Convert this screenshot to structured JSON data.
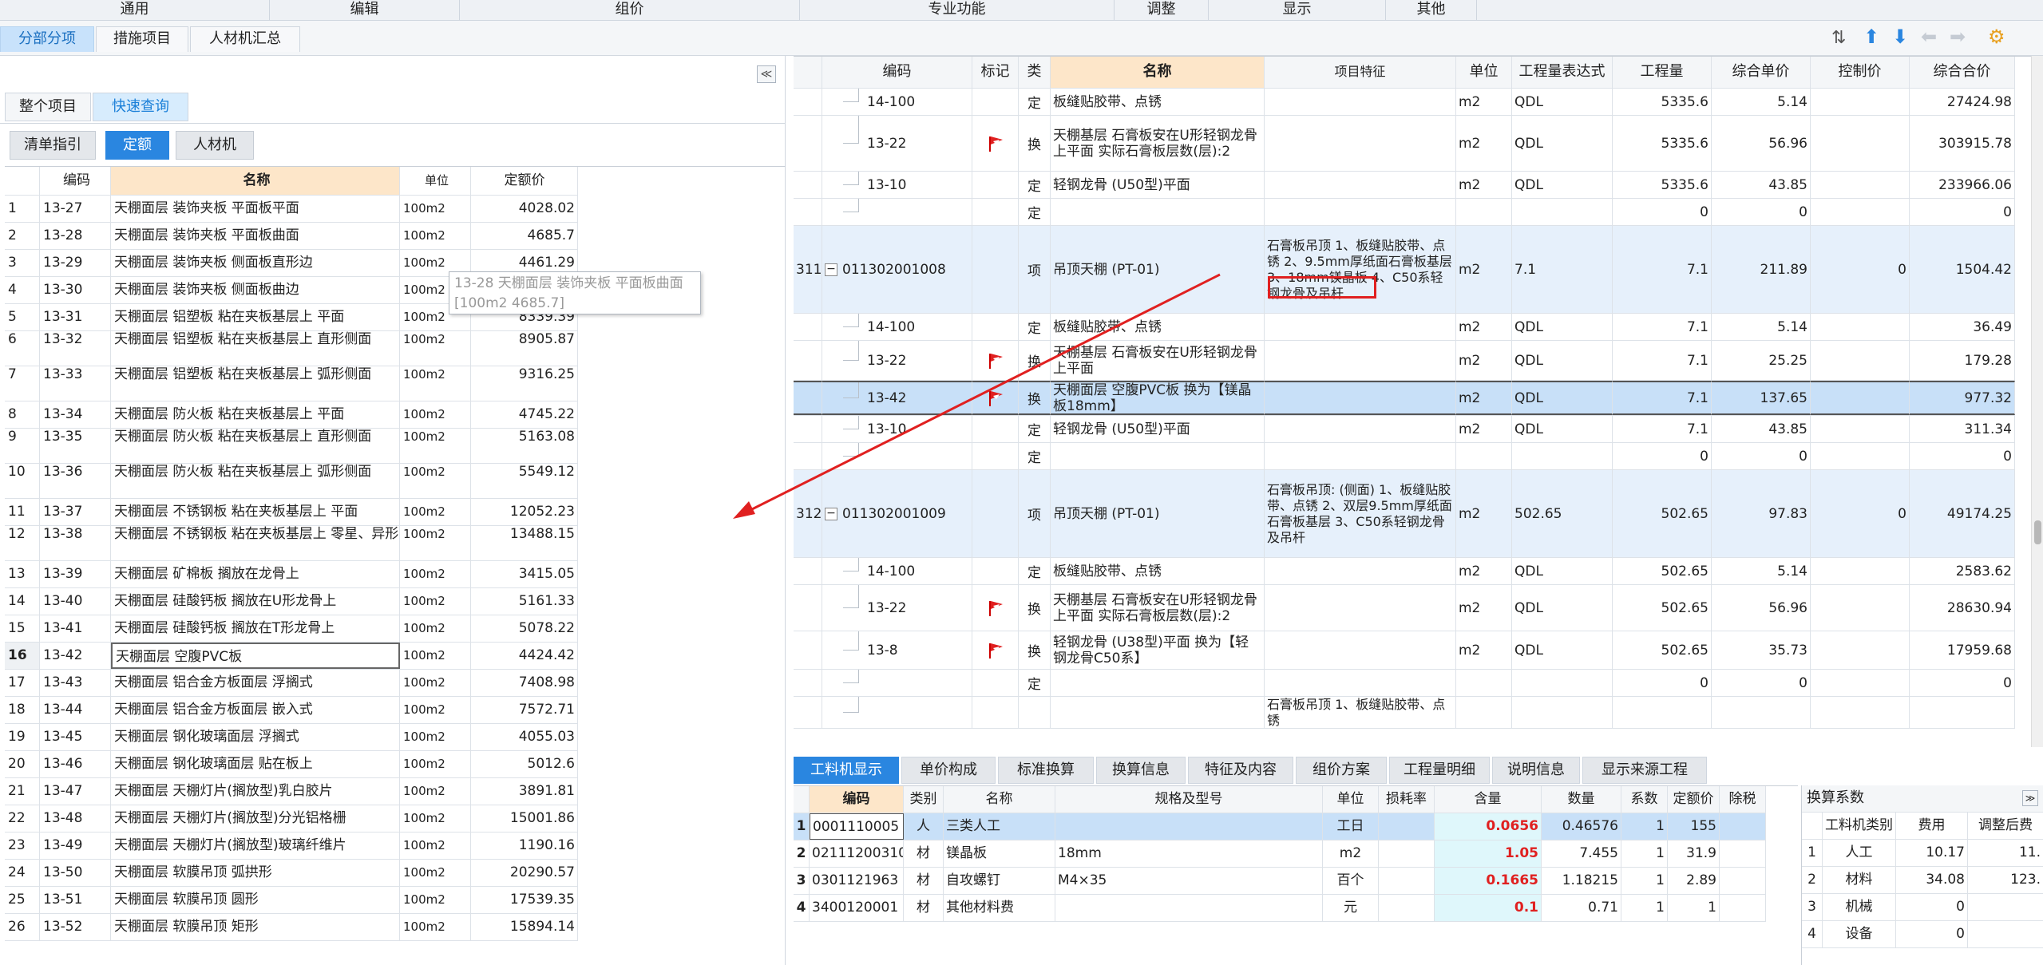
{
  "ribbon": [
    "通用",
    "编辑",
    "组价",
    "专业功能",
    "调整",
    "显示",
    "其他"
  ],
  "top_tabs": [
    "分部分项",
    "措施项目",
    "人材机汇总"
  ],
  "left": {
    "scope_tabs": [
      "整个项目",
      "快速查询"
    ],
    "filter_tabs": [
      "清单指引",
      "定额",
      "人材机"
    ],
    "headers": {
      "code": "编码",
      "name": "名称",
      "unit": "单位",
      "price": "定额价"
    },
    "rows": [
      {
        "n": "1",
        "code": "13-27",
        "name": "天棚面层 装饰夹板 平面板平面",
        "unit": "100m2",
        "price": "4028.02"
      },
      {
        "n": "2",
        "code": "13-28",
        "name": "天棚面层 装饰夹板 平面板曲面",
        "unit": "100m2",
        "price": "4685.7"
      },
      {
        "n": "3",
        "code": "13-29",
        "name": "天棚面层 装饰夹板 侧面板直形边",
        "unit": "100m2",
        "price": "4461.29"
      },
      {
        "n": "4",
        "code": "13-30",
        "name": "天棚面层 装饰夹板 侧面板曲边",
        "unit": "100m2",
        "price": ""
      },
      {
        "n": "5",
        "code": "13-31",
        "name": "天棚面层 铝塑板 粘在夹板基层上 平面",
        "unit": "100m2",
        "price": "8339.39"
      },
      {
        "n": "6",
        "code": "13-32",
        "name": "天棚面层 铝塑板 粘在夹板基层上 直形侧面",
        "unit": "100m2",
        "price": "8905.87"
      },
      {
        "n": "7",
        "code": "13-33",
        "name": "天棚面层 铝塑板 粘在夹板基层上 弧形侧面",
        "unit": "100m2",
        "price": "9316.25"
      },
      {
        "n": "8",
        "code": "13-34",
        "name": "天棚面层 防火板 粘在夹板基层上 平面",
        "unit": "100m2",
        "price": "4745.22"
      },
      {
        "n": "9",
        "code": "13-35",
        "name": "天棚面层 防火板 粘在夹板基层上 直形侧面",
        "unit": "100m2",
        "price": "5163.08"
      },
      {
        "n": "10",
        "code": "13-36",
        "name": "天棚面层 防火板 粘在夹板基层上 弧形侧面",
        "unit": "100m2",
        "price": "5549.12"
      },
      {
        "n": "11",
        "code": "13-37",
        "name": "天棚面层 不锈钢板 粘在夹板基层上 平面",
        "unit": "100m2",
        "price": "12052.23"
      },
      {
        "n": "12",
        "code": "13-38",
        "name": "天棚面层 不锈钢板 粘在夹板基层上 零星、异形",
        "unit": "100m2",
        "price": "13488.15"
      },
      {
        "n": "13",
        "code": "13-39",
        "name": "天棚面层 矿棉板 搁放在龙骨上",
        "unit": "100m2",
        "price": "3415.05"
      },
      {
        "n": "14",
        "code": "13-40",
        "name": "天棚面层 硅酸钙板 搁放在U形龙骨上",
        "unit": "100m2",
        "price": "5161.33"
      },
      {
        "n": "15",
        "code": "13-41",
        "name": "天棚面层 硅酸钙板 搁放在T形龙骨上",
        "unit": "100m2",
        "price": "5078.22"
      },
      {
        "n": "16",
        "code": "13-42",
        "name": "天棚面层 空腹PVC板",
        "unit": "100m2",
        "price": "4424.42"
      },
      {
        "n": "17",
        "code": "13-43",
        "name": "天棚面层 铝合金方板面层 浮搁式",
        "unit": "100m2",
        "price": "7408.98"
      },
      {
        "n": "18",
        "code": "13-44",
        "name": "天棚面层 铝合金方板面层 嵌入式",
        "unit": "100m2",
        "price": "7572.71"
      },
      {
        "n": "19",
        "code": "13-45",
        "name": "天棚面层 钢化玻璃面层 浮搁式",
        "unit": "100m2",
        "price": "4055.03"
      },
      {
        "n": "20",
        "code": "13-46",
        "name": "天棚面层 钢化玻璃面层 贴在板上",
        "unit": "100m2",
        "price": "5012.6"
      },
      {
        "n": "21",
        "code": "13-47",
        "name": "天棚面层 天棚灯片(搁放型)乳白胶片",
        "unit": "100m2",
        "price": "3891.81"
      },
      {
        "n": "22",
        "code": "13-48",
        "name": "天棚面层 天棚灯片(搁放型)分光铝格栅",
        "unit": "100m2",
        "price": "15001.86"
      },
      {
        "n": "23",
        "code": "13-49",
        "name": "天棚面层 天棚灯片(搁放型)玻璃纤维片",
        "unit": "100m2",
        "price": "1190.16"
      },
      {
        "n": "24",
        "code": "13-50",
        "name": "天棚面层 软膜吊顶 弧拱形",
        "unit": "100m2",
        "price": "20290.57"
      },
      {
        "n": "25",
        "code": "13-51",
        "name": "天棚面层 软膜吊顶 圆形",
        "unit": "100m2",
        "price": "17539.35"
      },
      {
        "n": "26",
        "code": "13-52",
        "name": "天棚面层 软膜吊顶 矩形",
        "unit": "100m2",
        "price": "15894.14"
      }
    ],
    "tooltip": {
      "line1": "13-28 天棚面层 装饰夹板 平面板曲面",
      "line2": "[100m2 4685.7]"
    }
  },
  "right": {
    "headers": {
      "code": "编码",
      "mark": "标记",
      "type": "类别",
      "name": "名称",
      "feature": "项目特征",
      "unit": "单位",
      "expr": "工程量表达式",
      "qty": "工程量",
      "price": "综合单价",
      "ctrl": "控制价",
      "total": "综合合价"
    },
    "rows": [
      {
        "num": "",
        "code": "14-100",
        "type": "定",
        "name": "板缝贴胶带、点锈",
        "feature": "",
        "unit": "m2",
        "expr": "QDL",
        "qty": "5335.6",
        "price": "5.14",
        "ctrl": "",
        "total": "27424.98"
      },
      {
        "num": "",
        "code": "13-22",
        "type": "换",
        "name": "天棚基层 石膏板安在U形轻钢龙骨 上平面 实际石膏板层数(层):2",
        "feature": "",
        "unit": "m2",
        "expr": "QDL",
        "qty": "5335.6",
        "price": "56.96",
        "ctrl": "",
        "total": "303915.78"
      },
      {
        "num": "",
        "code": "13-10",
        "type": "定",
        "name": "轻钢龙骨 (U50型)平面",
        "feature": "",
        "unit": "m2",
        "expr": "QDL",
        "qty": "5335.6",
        "price": "43.85",
        "ctrl": "",
        "total": "233966.06"
      },
      {
        "num": "",
        "code": "",
        "type": "定",
        "name": "",
        "feature": "",
        "unit": "",
        "expr": "",
        "qty": "0",
        "price": "0",
        "ctrl": "",
        "total": "0"
      },
      {
        "num": "311",
        "code": "011302001008",
        "type": "项",
        "name": "吊顶天棚 (PT-01)",
        "feature": "石膏板吊顶 1、板缝贴胶带、点锈 2、9.5mm厚纸面石膏板基层 3、18mm镁晶板 4、C50系轻钢龙骨及吊杆",
        "unit": "m2",
        "expr": "7.1",
        "qty": "7.1",
        "price": "211.89",
        "ctrl": "0",
        "total": "1504.42"
      },
      {
        "num": "",
        "code": "14-100",
        "type": "定",
        "name": "板缝贴胶带、点锈",
        "feature": "",
        "unit": "m2",
        "expr": "QDL",
        "qty": "7.1",
        "price": "5.14",
        "ctrl": "",
        "total": "36.49"
      },
      {
        "num": "",
        "code": "13-22",
        "type": "换",
        "name": "天棚基层 石膏板安在U形轻钢龙骨 上平面",
        "feature": "",
        "unit": "m2",
        "expr": "QDL",
        "qty": "7.1",
        "price": "25.25",
        "ctrl": "",
        "total": "179.28"
      },
      {
        "num": "",
        "code": "13-42",
        "type": "换",
        "name": "天棚面层 空腹PVC板 换为【镁晶板18mm】",
        "feature": "",
        "unit": "m2",
        "expr": "QDL",
        "qty": "7.1",
        "price": "137.65",
        "ctrl": "",
        "total": "977.32"
      },
      {
        "num": "",
        "code": "13-10",
        "type": "定",
        "name": "轻钢龙骨 (U50型)平面",
        "feature": "",
        "unit": "m2",
        "expr": "QDL",
        "qty": "7.1",
        "price": "43.85",
        "ctrl": "",
        "total": "311.34"
      },
      {
        "num": "",
        "code": "",
        "type": "定",
        "name": "",
        "feature": "",
        "unit": "",
        "expr": "",
        "qty": "0",
        "price": "0",
        "ctrl": "",
        "total": "0"
      },
      {
        "num": "312",
        "code": "011302001009",
        "type": "项",
        "name": "吊顶天棚 (PT-01)",
        "feature": "石膏板吊顶: (侧面) 1、板缝贴胶带、点锈 2、双层9.5mm厚纸面石膏板基层 3、C50系轻钢龙骨及吊杆",
        "unit": "m2",
        "expr": "502.65",
        "qty": "502.65",
        "price": "97.83",
        "ctrl": "0",
        "total": "49174.25"
      },
      {
        "num": "",
        "code": "14-100",
        "type": "定",
        "name": "板缝贴胶带、点锈",
        "feature": "",
        "unit": "m2",
        "expr": "QDL",
        "qty": "502.65",
        "price": "5.14",
        "ctrl": "",
        "total": "2583.62"
      },
      {
        "num": "",
        "code": "13-22",
        "type": "换",
        "name": "天棚基层 石膏板安在U形轻钢龙骨 上平面 实际石膏板层数(层):2",
        "feature": "",
        "unit": "m2",
        "expr": "QDL",
        "qty": "502.65",
        "price": "56.96",
        "ctrl": "",
        "total": "28630.94"
      },
      {
        "num": "",
        "code": "13-8",
        "type": "换",
        "name": "轻钢龙骨 (U38型)平面 换为【轻钢龙骨C50系】",
        "feature": "",
        "unit": "m2",
        "expr": "QDL",
        "qty": "502.65",
        "price": "35.73",
        "ctrl": "",
        "total": "17959.68"
      },
      {
        "num": "",
        "code": "",
        "type": "定",
        "name": "",
        "feature": "",
        "unit": "",
        "expr": "",
        "qty": "0",
        "price": "0",
        "ctrl": "",
        "total": "0"
      },
      {
        "num": "",
        "code": "",
        "type": "",
        "name": "",
        "feature": "石膏板吊顶 1、板缝贴胶带、点锈",
        "unit": "",
        "expr": "",
        "qty": "",
        "price": "",
        "ctrl": "",
        "total": ""
      }
    ]
  },
  "bottom_tabs": [
    "工料机显示",
    "单价构成",
    "标准换算",
    "换算信息",
    "特征及内容",
    "组价方案",
    "工程量明细",
    "说明信息",
    "显示来源工程"
  ],
  "bottom": {
    "headers": {
      "code": "编码",
      "type": "类别",
      "name": "名称",
      "spec": "规格及型号",
      "unit": "单位",
      "loss": "损耗率",
      "content": "含量",
      "amount": "数量",
      "coef": "系数",
      "price": "定额价",
      "tax": "除税"
    },
    "rows": [
      {
        "n": "1",
        "code": "0001110005",
        "type": "人",
        "name": "三类人工",
        "spec": "",
        "unit": "工日",
        "loss": "",
        "content": "0.0656",
        "amount": "0.46576",
        "coef": "1",
        "price": "155"
      },
      {
        "n": "2",
        "code": "02111200310@3",
        "type": "材",
        "name": "镁晶板",
        "spec": "18mm",
        "unit": "m2",
        "loss": "",
        "content": "1.05",
        "amount": "7.455",
        "coef": "1",
        "price": "31.9"
      },
      {
        "n": "3",
        "code": "0301121963",
        "type": "材",
        "name": "自攻螺钉",
        "spec": "M4×35",
        "unit": "百个",
        "loss": "",
        "content": "0.1665",
        "amount": "1.18215",
        "coef": "1",
        "price": "2.89"
      },
      {
        "n": "4",
        "code": "3400120001",
        "type": "材",
        "name": "其他材料费",
        "spec": "",
        "unit": "元",
        "loss": "",
        "content": "0.1",
        "amount": "0.71",
        "coef": "1",
        "price": "1"
      }
    ]
  },
  "conversion": {
    "title": "换算系数",
    "headers": {
      "type": "工料机类别",
      "fee": "费用",
      "adj": "调整后费"
    },
    "rows": [
      {
        "n": "1",
        "type": "人工",
        "fee": "10.17",
        "adj": "11."
      },
      {
        "n": "2",
        "type": "材料",
        "fee": "34.08",
        "adj": "123."
      },
      {
        "n": "3",
        "type": "机械",
        "fee": "0",
        "adj": ""
      },
      {
        "n": "4",
        "type": "设备",
        "fee": "0",
        "adj": ""
      }
    ]
  },
  "colors": {
    "accent": "#2a86e0",
    "header_highlight": "#fde6c9",
    "selection": "#c8e0f8",
    "annotation": "#e02020"
  }
}
